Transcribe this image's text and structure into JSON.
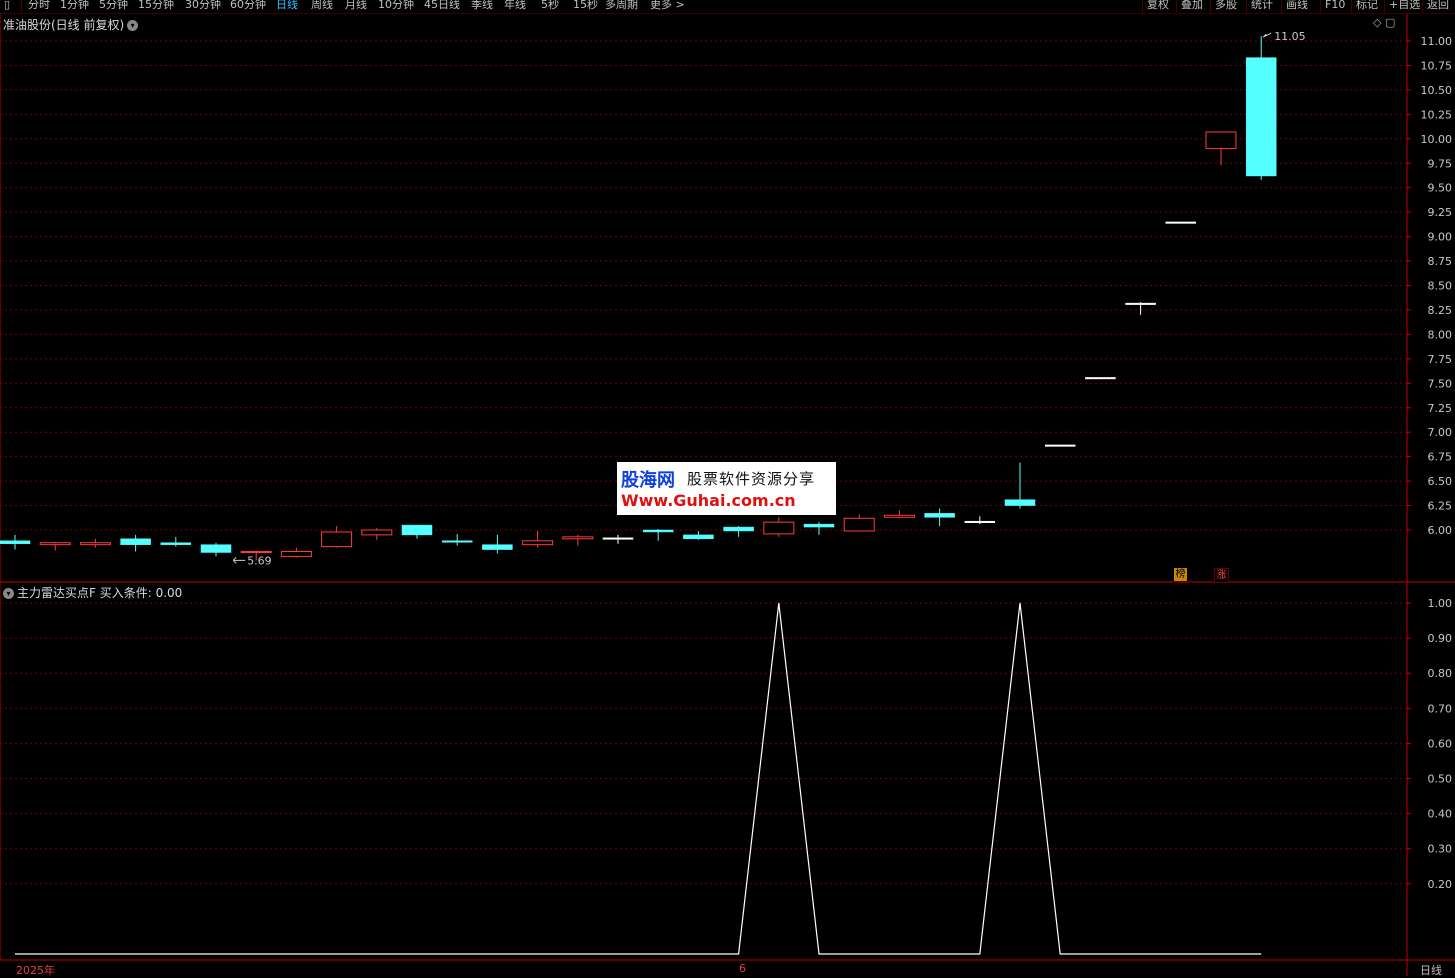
{
  "toolbar": {
    "left_items": [
      "分时",
      "1分钟",
      "5分钟",
      "15分钟",
      "30分钟",
      "60分钟",
      "日线",
      "周线",
      "月线",
      "10分钟",
      "45日线",
      "季线",
      "年线",
      "5秒",
      "15秒",
      "多周期",
      "更多 >"
    ],
    "active_item": "日线",
    "right_items": [
      "复权",
      "叠加",
      "多股",
      "统计",
      "画线",
      "F10",
      "标记",
      "+自选",
      "返回"
    ]
  },
  "stock_title": "准油股份(日线 前复权)",
  "indicator_title": "主力雷达买点F  买入条件: 0.00",
  "bottom": {
    "left_label": "2025年",
    "mid_label": "6",
    "right_label": "日线"
  },
  "badges": {
    "bang": "榜",
    "zhang": "涨"
  },
  "watermark": {
    "line1": "股海网",
    "line1b": "股票软件资源分享",
    "line2": "Www.Guhai.com.cn"
  },
  "colors": {
    "up": "#ff3c3c",
    "down": "#54ffff",
    "flat": "#ffffff",
    "grid": "#7a0000",
    "axis": "#c00000",
    "line": "#ffffff"
  },
  "chart_data": [
    {
      "type": "candlestick",
      "title": "准油股份(日线 前复权)",
      "y_ticks": [
        "11.00",
        "10.75",
        "10.50",
        "10.25",
        "10.00",
        "9.75",
        "9.50",
        "9.25",
        "9.00",
        "8.75",
        "8.50",
        "8.25",
        "8.00",
        "7.75",
        "7.50",
        "7.25",
        "7.00",
        "6.75",
        "6.50",
        "6.25",
        "6.00"
      ],
      "ylim": [
        5.55,
        11.25
      ],
      "annotations": [
        {
          "label": "11.05",
          "type": "high"
        },
        {
          "label": "5.69",
          "type": "low"
        }
      ],
      "candles": [
        {
          "o": 5.89,
          "h": 5.95,
          "l": 5.8,
          "c": 5.86
        },
        {
          "o": 5.85,
          "h": 5.88,
          "l": 5.79,
          "c": 5.87
        },
        {
          "o": 5.85,
          "h": 5.91,
          "l": 5.82,
          "c": 5.87
        },
        {
          "o": 5.91,
          "h": 5.95,
          "l": 5.78,
          "c": 5.85
        },
        {
          "o": 5.87,
          "h": 5.93,
          "l": 5.83,
          "c": 5.85
        },
        {
          "o": 5.85,
          "h": 5.87,
          "l": 5.73,
          "c": 5.77
        },
        {
          "o": 5.77,
          "h": 5.79,
          "l": 5.69,
          "c": 5.78
        },
        {
          "o": 5.73,
          "h": 5.82,
          "l": 5.72,
          "c": 5.78
        },
        {
          "o": 5.83,
          "h": 6.04,
          "l": 5.82,
          "c": 5.98
        },
        {
          "o": 5.95,
          "h": 6.02,
          "l": 5.9,
          "c": 6.0
        },
        {
          "o": 6.05,
          "h": 6.05,
          "l": 5.91,
          "c": 5.95
        },
        {
          "o": 5.89,
          "h": 5.96,
          "l": 5.84,
          "c": 5.88
        },
        {
          "o": 5.85,
          "h": 5.95,
          "l": 5.76,
          "c": 5.8
        },
        {
          "o": 5.85,
          "h": 5.99,
          "l": 5.82,
          "c": 5.89
        },
        {
          "o": 5.91,
          "h": 5.95,
          "l": 5.84,
          "c": 5.93
        },
        {
          "o": 5.92,
          "h": 5.95,
          "l": 5.86,
          "c": 5.92
        },
        {
          "o": 6.0,
          "h": 6.01,
          "l": 5.89,
          "c": 5.98
        },
        {
          "o": 5.95,
          "h": 5.99,
          "l": 5.9,
          "c": 5.91
        },
        {
          "o": 6.03,
          "h": 6.04,
          "l": 5.93,
          "c": 5.99
        },
        {
          "o": 5.96,
          "h": 6.13,
          "l": 5.93,
          "c": 6.08
        },
        {
          "o": 6.06,
          "h": 6.08,
          "l": 5.95,
          "c": 6.03
        },
        {
          "o": 5.99,
          "h": 6.16,
          "l": 5.99,
          "c": 6.12
        },
        {
          "o": 6.13,
          "h": 6.2,
          "l": 6.12,
          "c": 6.15
        },
        {
          "o": 6.17,
          "h": 6.22,
          "l": 6.04,
          "c": 6.13
        },
        {
          "o": 6.09,
          "h": 6.14,
          "l": 6.06,
          "c": 6.09
        },
        {
          "o": 6.31,
          "h": 6.69,
          "l": 6.22,
          "c": 6.25
        },
        {
          "o": 6.87,
          "h": 6.87,
          "l": 6.87,
          "c": 6.87
        },
        {
          "o": 7.56,
          "h": 7.56,
          "l": 7.56,
          "c": 7.56
        },
        {
          "o": 8.32,
          "h": 8.33,
          "l": 8.2,
          "c": 8.32
        },
        {
          "o": 9.15,
          "h": 9.15,
          "l": 9.15,
          "c": 9.15
        },
        {
          "o": 9.9,
          "h": 10.07,
          "l": 9.73,
          "c": 10.07
        },
        {
          "o": 10.83,
          "h": 11.05,
          "l": 9.58,
          "c": 9.62
        }
      ]
    },
    {
      "type": "line",
      "title": "主力雷达买点F",
      "y_ticks": [
        "1.00",
        "0.90",
        "0.80",
        "0.70",
        "0.60",
        "0.50",
        "0.40",
        "0.30",
        "0.20"
      ],
      "ylim": [
        0,
        1.05
      ],
      "series": [
        {
          "name": "买入条件",
          "values": [
            0,
            0,
            0,
            0,
            0,
            0,
            0,
            0,
            0,
            0,
            0,
            0,
            0,
            0,
            0,
            0,
            0,
            0,
            0,
            1,
            0,
            0,
            0,
            0,
            0,
            1,
            0,
            0,
            0,
            0,
            0,
            0
          ]
        }
      ]
    }
  ]
}
